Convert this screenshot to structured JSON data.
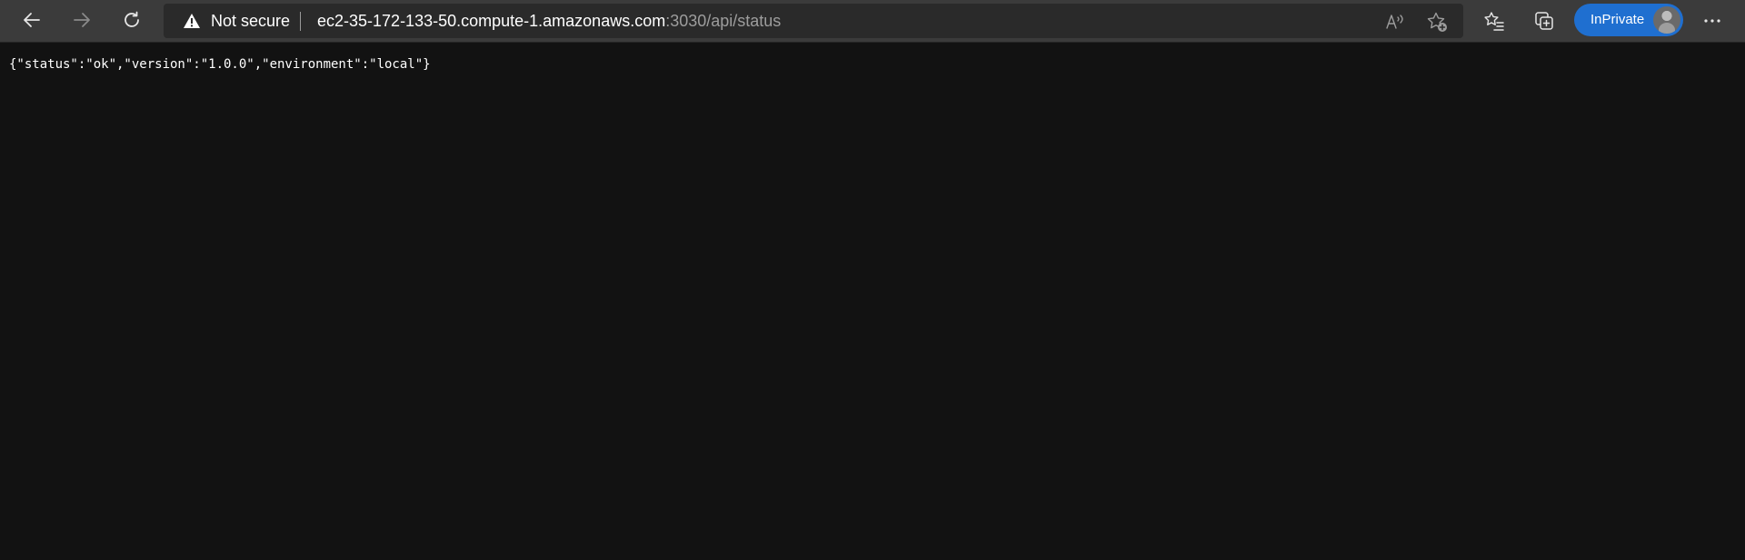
{
  "browser": {
    "security_label": "Not secure",
    "url_host": "ec2-35-172-133-50.compute-1.amazonaws.com",
    "url_rest": ":3030/api/status",
    "profile_label": "InPrivate",
    "icons": {
      "back": "back-arrow-icon",
      "forward": "forward-arrow-icon",
      "refresh": "refresh-icon",
      "warning": "warning-triangle-icon",
      "read_aloud": "read-aloud-icon",
      "add_favorite": "add-favorite-icon",
      "favorites": "favorites-icon",
      "collections": "collections-icon",
      "menu": "more-menu-icon"
    },
    "colors": {
      "toolbar": "#3b3b3b",
      "addressbar": "#2a2a2a",
      "inprivate": "#1f6fd0",
      "page_bg": "#121212"
    }
  },
  "page": {
    "body_text": "{\"status\":\"ok\",\"version\":\"1.0.0\",\"environment\":\"local\"}"
  }
}
